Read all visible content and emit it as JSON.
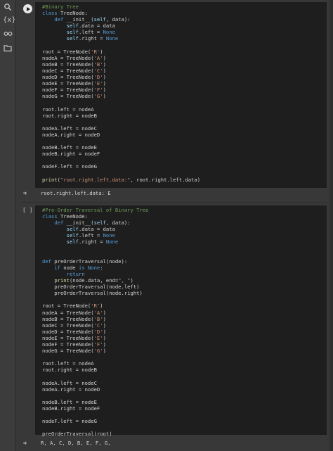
{
  "sidebar": {
    "icons": [
      "search-icon",
      "variables-icon",
      "secrets-key-icon",
      "files-folder-icon"
    ],
    "variables_label": "{x}"
  },
  "cells": [
    {
      "execution_status": "run",
      "code_lines": [
        "#Binary Tree",
        "class TreeNode:",
        "    def __init__(self, data):",
        "        self.data = data",
        "        self.left = None",
        "        self.right = None",
        "",
        "root = TreeNode('R')",
        "nodeA = TreeNode('A')",
        "nodeB = TreeNode('B')",
        "nodeC = TreeNode('C')",
        "nodeD = TreeNode('D')",
        "nodeE = TreeNode('E')",
        "nodeF = TreeNode('F')",
        "nodeG = TreeNode('G')",
        "",
        "root.left = nodeA",
        "root.right = nodeB",
        "",
        "nodeA.left = nodeC",
        "nodeA.right = nodeD",
        "",
        "nodeB.left = nodeE",
        "nodeB.right = nodeF",
        "",
        "nodeF.left = nodeG",
        "",
        "print(\"root.right.left.data:\", root.right.left.data)"
      ],
      "output": "root.right.left.data: E"
    },
    {
      "execution_status": "[ ]",
      "code_lines": [
        "#Pre-Order Traversal of Binary Tree",
        "class TreeNode:",
        "    def __init__(self, data):",
        "        self.data = data",
        "        self.left = None",
        "        self.right = None",
        "",
        "",
        "def preOrderTraversal(node):",
        "    if node is None:",
        "        return",
        "    print(node.data, end=\", \")",
        "    preOrderTraversal(node.left)",
        "    preOrderTraversal(node.right)",
        "",
        "root = TreeNode('R')",
        "nodeA = TreeNode('A')",
        "nodeB = TreeNode('B')",
        "nodeC = TreeNode('C')",
        "nodeD = TreeNode('D')",
        "nodeE = TreeNode('E')",
        "nodeF = TreeNode('F')",
        "nodeG = TreeNode('G')",
        "",
        "root.left = nodeA",
        "root.right = nodeB",
        "",
        "nodeA.left = nodeC",
        "nodeA.right = nodeD",
        "",
        "nodeB.left = nodeE",
        "nodeB.right = nodeF",
        "",
        "nodeF.left = nodeG",
        "",
        "preOrderTraversal(root)"
      ],
      "output": "R, A, C, D, B, E, F, G,"
    }
  ]
}
